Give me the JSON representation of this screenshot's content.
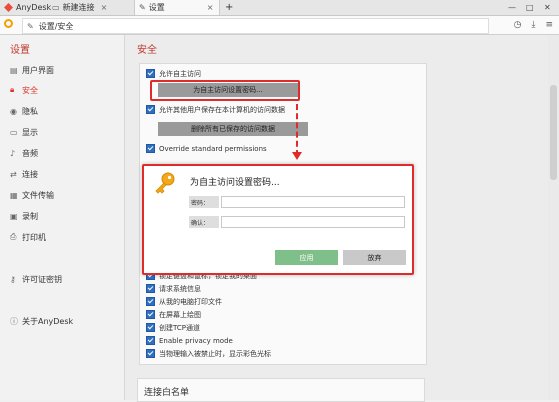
{
  "tabs": [
    {
      "label": "AnyDesk"
    },
    {
      "label": "新建连接"
    },
    {
      "label": "设置"
    }
  ],
  "tab_close": "×",
  "new_tab": "+",
  "window_controls": {
    "min": "—",
    "max": "□",
    "close": "✕"
  },
  "address": {
    "text": "设置/安全"
  },
  "sidebar": {
    "title": "设置",
    "items": [
      {
        "label": "用户界面",
        "icon": "ui-icon"
      },
      {
        "label": "安全",
        "icon": "lock-icon",
        "active": true
      },
      {
        "label": "隐私",
        "icon": "privacy-icon"
      },
      {
        "label": "显示",
        "icon": "monitor-icon"
      },
      {
        "label": "音频",
        "icon": "audio-icon"
      },
      {
        "label": "连接",
        "icon": "connection-icon"
      },
      {
        "label": "文件传输",
        "icon": "file-transfer-icon"
      },
      {
        "label": "录制",
        "icon": "record-icon"
      },
      {
        "label": "打印机",
        "icon": "printer-icon"
      },
      {
        "label": "许可证密钥",
        "icon": "key-icon"
      },
      {
        "label": "关于AnyDesk",
        "icon": "info-icon"
      }
    ]
  },
  "main": {
    "title": "安全",
    "top_options": [
      "允许自主访问",
      "允许其他用户保存在本计算机的访问数据",
      "Override standard permissions"
    ],
    "set_password_button": "为自主访问设置密码...",
    "delete_data_button": "删除所有已保存的访问数据",
    "bottom_options": [
      "请求系统信息",
      "从我的电脑打印文件",
      "在屏幕上绘图",
      "创建TCP通道",
      "Enable privacy mode",
      "当物理输入被禁止时，显示彩色光标"
    ],
    "partial_option": "锁定键盘和鼠标，锁定我的桌面",
    "whitelist_title": "连接白名单"
  },
  "dialog": {
    "title": "为自主访问设置密码...",
    "password_label": "密码：",
    "confirm_label": "确认：",
    "password_value": "",
    "confirm_value": "",
    "apply": "应用",
    "cancel": "放弃"
  },
  "colors": {
    "accent": "#c0392b",
    "highlight": "#e02b2b",
    "apply": "#7fbf8a"
  }
}
